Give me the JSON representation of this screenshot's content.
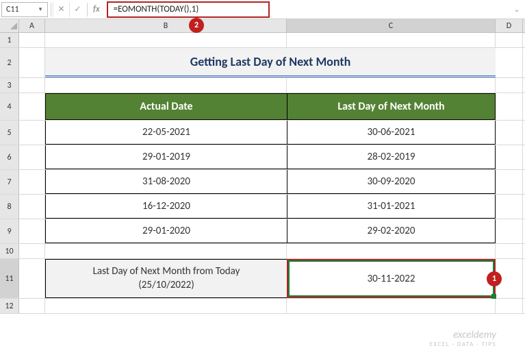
{
  "nameBox": "C11",
  "formula": "=EOMONTH(TODAY(),1)",
  "badges": {
    "two": "2",
    "one": "1"
  },
  "columns": {
    "A": "A",
    "B": "B",
    "C": "C",
    "D": "D"
  },
  "rowNums": {
    "r1": "1",
    "r2": "2",
    "r3": "3",
    "r4": "4",
    "r5": "5",
    "r6": "6",
    "r7": "7",
    "r8": "8",
    "r9": "9",
    "r10": "10",
    "r11": "11",
    "r12": "12"
  },
  "title": "Getting Last Day of Next Month",
  "table": {
    "headerB": "Actual Date",
    "headerC": "Last Day of Next Month",
    "rows": [
      {
        "b": "22-05-2021",
        "c": "30-06-2021"
      },
      {
        "b": "29-01-2019",
        "c": "28-02-2019"
      },
      {
        "b": "31-08-2020",
        "c": "30-09-2020"
      },
      {
        "b": "16-12-2020",
        "c": "31-01-2021"
      },
      {
        "b": "29-01-2020",
        "c": "29-02-2020"
      }
    ]
  },
  "row11": {
    "label1": "Last Day of Next Month from Today",
    "label2": "(25/10/2022)",
    "value": "30-11-2022"
  },
  "watermark": {
    "brand": "exceldemy",
    "tag": "EXCEL · DATA · TIPS"
  },
  "chart_data": {
    "type": "table",
    "title": "Getting Last Day of Next Month",
    "columns": [
      "Actual Date",
      "Last Day of Next Month"
    ],
    "rows": [
      [
        "22-05-2021",
        "30-06-2021"
      ],
      [
        "29-01-2019",
        "28-02-2019"
      ],
      [
        "31-08-2020",
        "30-09-2020"
      ],
      [
        "16-12-2020",
        "31-01-2021"
      ],
      [
        "29-01-2020",
        "29-02-2020"
      ]
    ],
    "computed": {
      "label": "Last Day of Next Month from Today (25/10/2022)",
      "value": "30-11-2022",
      "formula": "=EOMONTH(TODAY(),1)"
    }
  }
}
